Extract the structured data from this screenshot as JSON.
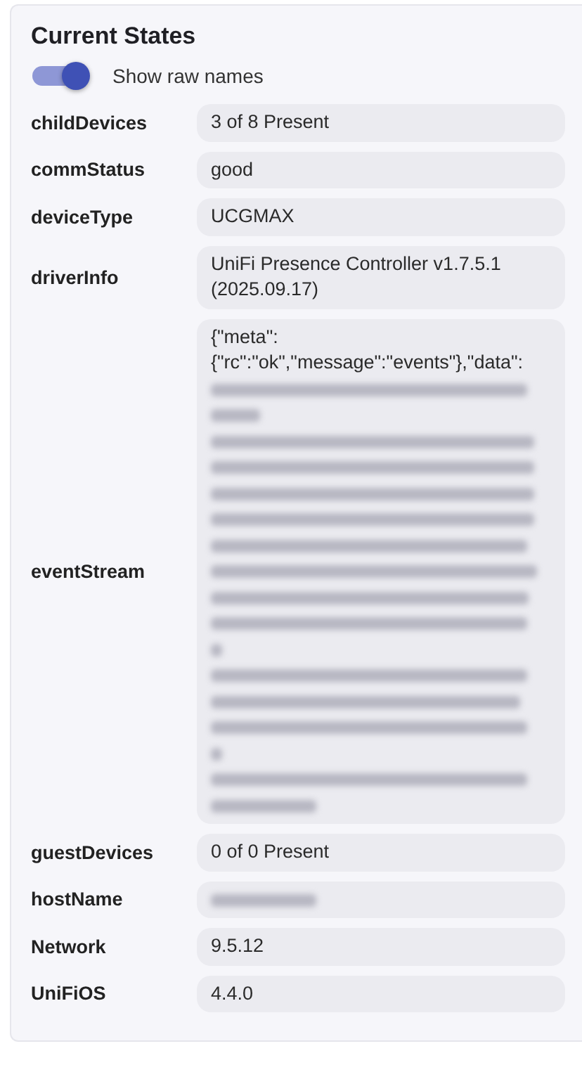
{
  "title": "Current States",
  "toggle": {
    "label": "Show raw names",
    "on": true
  },
  "states": [
    {
      "name": "childDevices",
      "lines": [
        {
          "text": "3 of 8 Present"
        }
      ]
    },
    {
      "name": "commStatus",
      "lines": [
        {
          "text": "good"
        }
      ]
    },
    {
      "name": "deviceType",
      "lines": [
        {
          "text": "UCGMAX"
        }
      ]
    },
    {
      "name": "driverInfo",
      "lines": [
        {
          "text": "UniFi Presence Controller v1.7.5.1"
        },
        {
          "text": "(2025.09.17)"
        }
      ]
    },
    {
      "name": "eventStream",
      "lines": [
        {
          "text": "{\"meta\":"
        },
        {
          "text": "{\"rc\":\"ok\",\"message\":\"events\"},\"data\":"
        },
        {
          "blurred": true
        },
        {
          "blurred": true
        },
        {
          "blurred": true
        },
        {
          "blurred": true
        },
        {
          "blurred": true
        },
        {
          "blurred": true
        },
        {
          "blurred": true
        },
        {
          "blurred": true
        },
        {
          "blurred": true
        },
        {
          "blurred": true
        },
        {
          "blurred": true
        },
        {
          "blurred": true
        },
        {
          "blurred": true
        },
        {
          "blurred": true
        },
        {
          "blurred": true
        },
        {
          "blurred": true
        },
        {
          "blurred": true
        }
      ]
    },
    {
      "name": "guestDevices",
      "lines": [
        {
          "text": "0 of 0 Present"
        }
      ]
    },
    {
      "name": "hostName",
      "lines": [
        {
          "blurred": true
        }
      ]
    },
    {
      "name": "Network",
      "lines": [
        {
          "text": "9.5.12"
        }
      ]
    },
    {
      "name": "UniFiOS",
      "lines": [
        {
          "text": "4.4.0"
        }
      ]
    }
  ]
}
